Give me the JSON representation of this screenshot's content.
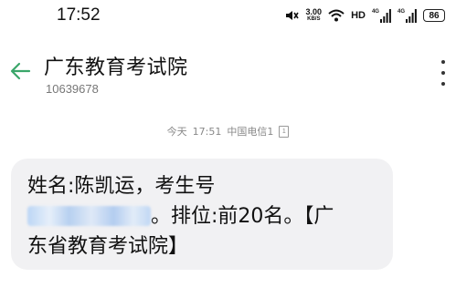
{
  "status_bar": {
    "time": "17:52",
    "net_speed_value": "3.00",
    "net_speed_unit": "KB/S",
    "hd_label": "HD",
    "signal_1_tag": "4G",
    "signal_2_tag": "4G",
    "battery": "86",
    "icons": [
      "mute-icon",
      "wifi-icon",
      "signal-icon",
      "signal-icon",
      "battery-icon"
    ]
  },
  "header": {
    "contact_name": "广东教育考试院",
    "contact_number": "10639678",
    "back_icon": "back-arrow-icon",
    "more_icon": "more-vertical-icon"
  },
  "message": {
    "day": "今天",
    "time": "17:51",
    "carrier": "中国电信1",
    "sim_icon": "sim-icon",
    "line1": "姓名:陈凯运，考生号",
    "line2_suffix": "。排位:前20名。【广",
    "line3": "东省教育考试院】"
  },
  "colors": {
    "accent": "#3aa66a",
    "bubble": "#f1f1f3"
  }
}
